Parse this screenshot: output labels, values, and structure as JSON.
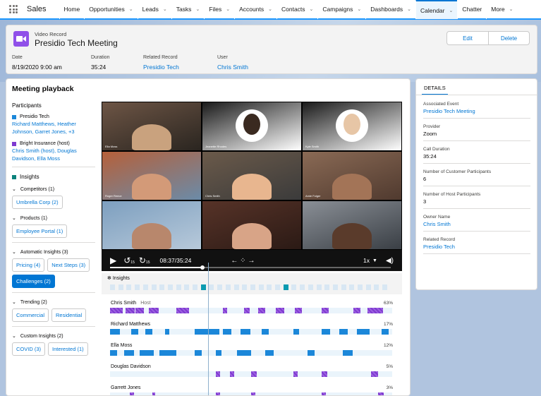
{
  "app": {
    "name": "Sales"
  },
  "nav": [
    {
      "label": "Home",
      "chev": false
    },
    {
      "label": "Opportunities",
      "chev": true
    },
    {
      "label": "Leads",
      "chev": true
    },
    {
      "label": "Tasks",
      "chev": true
    },
    {
      "label": "Files",
      "chev": true
    },
    {
      "label": "Accounts",
      "chev": true
    },
    {
      "label": "Contacts",
      "chev": true
    },
    {
      "label": "Campaigns",
      "chev": true
    },
    {
      "label": "Dashboards",
      "chev": true
    },
    {
      "label": "Calendar",
      "chev": true,
      "active": true
    },
    {
      "label": "Chatter",
      "chev": false
    },
    {
      "label": "More",
      "chev": true
    }
  ],
  "header": {
    "type": "Video Record",
    "title": "Presidio Tech Meeting",
    "edit": "Edit",
    "delete": "Delete",
    "date_label": "Date",
    "date": "8/19/2020 9:00 am",
    "duration_label": "Duration",
    "duration": "35:24",
    "related_label": "Related Record",
    "related": "Presidio Tech",
    "user_label": "User",
    "user": "Chris Smith"
  },
  "playback": {
    "title": "Meeting playback",
    "participants_title": "Participants",
    "org1": {
      "name": "Presidio Tech",
      "people": "Richard Matthews, Heather Johnson, Garret Jones, +3",
      "color": "#1b87d9"
    },
    "org2": {
      "name": "Bright Insurance (host)",
      "people": "Chris Smith (host), Douglas Davidson, Ella Moss",
      "color": "#7e3ad0"
    },
    "insights_title": "Insights",
    "groups": [
      {
        "label": "Competitors (1)",
        "pills": [
          {
            "label": "Umbrella Corp (2)"
          }
        ]
      },
      {
        "label": "Products (1)",
        "pills": [
          {
            "label": "Employee Portal (1)"
          }
        ]
      },
      {
        "label": "Automatic Insights (3)",
        "pills": [
          {
            "label": "Pricing (4)"
          },
          {
            "label": "Next Steps (3)"
          },
          {
            "label": "Challenges (2)",
            "selected": true
          }
        ]
      },
      {
        "label": "Trending (2)",
        "pills": [
          {
            "label": "Commercial"
          },
          {
            "label": "Residential"
          }
        ]
      },
      {
        "label": "Custom Insights (2)",
        "pills": [
          {
            "label": "COVID (3)"
          },
          {
            "label": "Interested (1)"
          }
        ]
      }
    ]
  },
  "video": {
    "time": "08:37/35:24",
    "speed": "1x",
    "back": "15",
    "fwd": "15",
    "progress": 0.33,
    "tiles": [
      "Ella Moss",
      "Jeanette Rhodes",
      "Kyle Smith",
      "Roger Reece",
      "Chris Smith",
      "Amie Folger",
      "",
      "",
      ""
    ]
  },
  "insights_label": "Insights",
  "speakers": [
    {
      "name": "Chris Smith",
      "role": "Host",
      "pct": "63%",
      "color": "purple"
    },
    {
      "name": "Richard Matthews",
      "role": "",
      "pct": "17%",
      "color": "blue"
    },
    {
      "name": "Ella Moss",
      "role": "",
      "pct": "12%",
      "color": "blue"
    },
    {
      "name": "Douglas Davidson",
      "role": "",
      "pct": "5%",
      "color": "purple"
    },
    {
      "name": "Garrett Jones",
      "role": "",
      "pct": "3%",
      "color": "purple"
    }
  ],
  "details": {
    "tab": "DETAILS",
    "fields": [
      {
        "label": "Associated Event",
        "value": "Presidio Tech Meeting",
        "link": true
      },
      {
        "label": "Provider",
        "value": "Zoom",
        "link": false
      },
      {
        "label": "Call Duration",
        "value": "35:24",
        "link": false
      },
      {
        "label": "Number of Customer Participants",
        "value": "6",
        "link": false
      },
      {
        "label": "Number of Host Participants",
        "value": "3",
        "link": false
      },
      {
        "label": "Owner Name",
        "value": "Chris Smith",
        "link": true
      },
      {
        "label": "Related Record",
        "value": "Presidio Tech",
        "link": true
      }
    ]
  }
}
